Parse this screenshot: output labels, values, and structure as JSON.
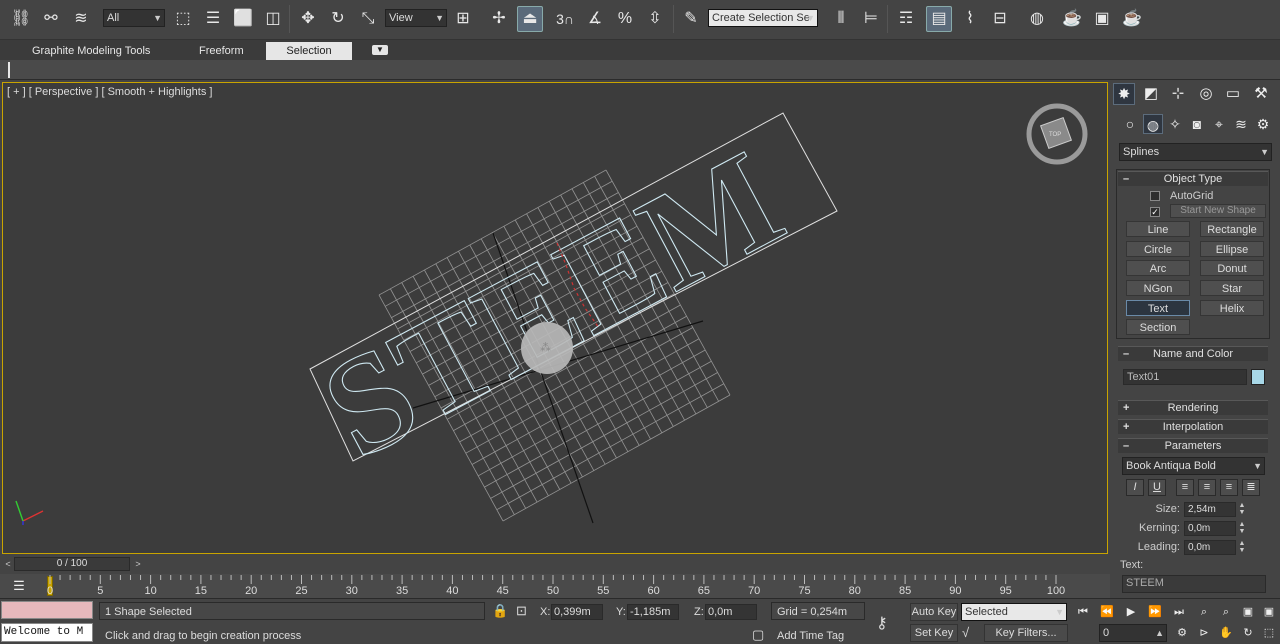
{
  "toolbar": {
    "selection_filter": "All",
    "reference_coord": "View",
    "named_selection_placeholder": "Create Selection Se",
    "snaps_toggle_label": "3",
    "icons": [
      "select-link-icon",
      "unlink-icon",
      "bind-space-warp-icon",
      "select-object-icon",
      "select-by-name-icon",
      "rectangular-region-icon",
      "window-crossing-icon",
      "select-move-icon",
      "select-rotate-icon",
      "select-scale-icon",
      "reference-coordinate-icon",
      "pivot-center-icon",
      "manipulate-icon",
      "keyboard-shortcut-icon",
      "snaps-toggle-icon",
      "angle-snap-icon",
      "percent-snap-icon",
      "spinner-snap-icon",
      "edit-named-selection-icon",
      "mirror-icon",
      "align-icon",
      "layer-manager-icon",
      "scene-explorer-icon",
      "curve-editor-icon",
      "schematic-view-icon",
      "material-editor-icon",
      "render-setup-icon",
      "rendered-frame-window-icon",
      "render-production-icon",
      "render-iterative-icon"
    ]
  },
  "ribbon": {
    "tabs": [
      "Graphite Modeling Tools",
      "Freeform",
      "Selection"
    ],
    "active_tab": "Selection"
  },
  "viewport": {
    "label": "[ + ] [ Perspective ] [ Smooth + Highlights ]",
    "viewcube_label": "TOP",
    "text_object": "STEEM"
  },
  "command_panel": {
    "category": "Splines",
    "object_type": {
      "title": "Object Type",
      "autogrid": "AutoGrid",
      "start_new_shape": "Start New Shape",
      "buttons": [
        "Line",
        "Rectangle",
        "Circle",
        "Ellipse",
        "Arc",
        "Donut",
        "NGon",
        "Star",
        "Text",
        "Helix",
        "Section"
      ],
      "active": "Text"
    },
    "name_and_color": {
      "title": "Name and Color",
      "name": "Text01",
      "color": "#a8d8e8"
    },
    "rollouts": {
      "rendering": "Rendering",
      "interpolation": "Interpolation",
      "parameters": "Parameters"
    },
    "parameters": {
      "font": "Book Antiqua Bold",
      "italic": "I",
      "underline": "U",
      "size_label": "Size:",
      "size": "2,54m",
      "kerning_label": "Kerning:",
      "kerning": "0,0m",
      "leading_label": "Leading:",
      "leading": "0,0m",
      "text_label": "Text:",
      "text_value": "STEEM"
    }
  },
  "time_slider": {
    "label": "0 / 100",
    "left": "<",
    "right": ">"
  },
  "trackbar": {
    "ticks": [
      "0",
      "5",
      "10",
      "15",
      "20",
      "25",
      "30",
      "35",
      "40",
      "45",
      "50",
      "55",
      "60",
      "65",
      "70",
      "75",
      "80",
      "85",
      "90",
      "95",
      "100"
    ]
  },
  "status": {
    "maxscript": "Welcome to M",
    "selection": "1 Shape Selected",
    "prompt": "Click and drag to begin creation process",
    "x_label": "X:",
    "x": "0,399m",
    "y_label": "Y:",
    "y": "-1,185m",
    "z_label": "Z:",
    "z": "0,0m",
    "grid": "Grid = 0,254m",
    "add_time_tag": "Add Time Tag",
    "auto_key": "Auto Key",
    "set_key": "Set Key",
    "key_mode": "Selected",
    "key_filters": "Key Filters...",
    "frame": "0"
  },
  "colors": {
    "accent": "#c9a400",
    "viewport_bg": "#3c3c3c",
    "spline": "#cfe9f2"
  }
}
